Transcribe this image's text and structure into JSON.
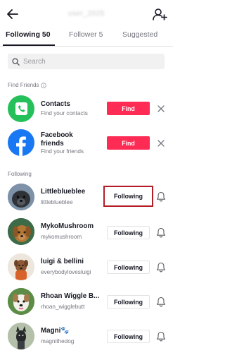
{
  "header": {
    "title_blurred": "user_2025"
  },
  "tabs": [
    {
      "label": "Following 50",
      "active": true
    },
    {
      "label": "Follower 5",
      "active": false
    },
    {
      "label": "Suggested",
      "active": false
    }
  ],
  "search": {
    "placeholder": "Search"
  },
  "find_friends": {
    "section_label": "Find Friends",
    "items": [
      {
        "title": "Contacts",
        "subtitle": "Find your contacts",
        "button": "Find"
      },
      {
        "title": "Facebook\nfriends",
        "subtitle": "Find your friends",
        "button": "Find"
      }
    ]
  },
  "following": {
    "section_label": "Following",
    "items": [
      {
        "name": "Littleblueblee",
        "handle": "littleblueblee",
        "button": "Following",
        "highlighted": true
      },
      {
        "name": "MykoMushroom",
        "handle": "mykomushroom",
        "button": "Following"
      },
      {
        "name": "luigi & bellini",
        "handle": "everybodylovesluigi",
        "button": "Following"
      },
      {
        "name": "Rhoan Wiggle B...",
        "handle": "rhoan_wigglebutt",
        "button": "Following"
      },
      {
        "name": "Magni🐾",
        "handle": "magnithedog",
        "button": "Following"
      }
    ]
  },
  "colors": {
    "find_button": "#fe2c55",
    "highlight_border": "#b31d27",
    "contacts_icon_bg": "#25c05a",
    "facebook_icon_bg": "#1877f2"
  }
}
